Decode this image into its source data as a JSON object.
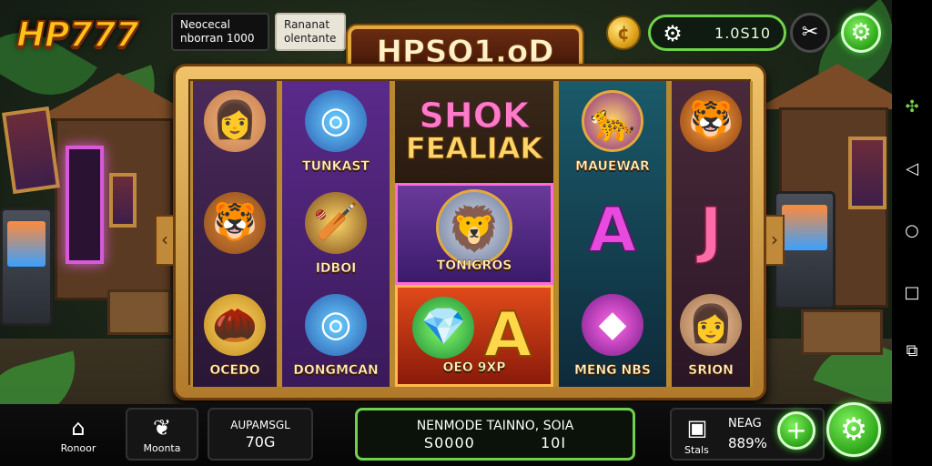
{
  "header": {
    "logo": "HP777",
    "info_left": {
      "line1": "Neocecal",
      "line2": "nborran 1000"
    },
    "info_right": {
      "line1": "Rananat",
      "line2": "olentante"
    },
    "game_title": "HPSO1.oD",
    "balance": "1.0S10"
  },
  "reels": [
    [
      {
        "icon": "woman-portrait-icon",
        "label": ""
      },
      {
        "icon": "tiger-head-icon",
        "label": ""
      },
      {
        "icon": "gold-pinecone-icon",
        "label": "OCEDO"
      }
    ],
    [
      {
        "icon": "blue-ring-icon",
        "label": "TUNKAST"
      },
      {
        "icon": "treasure-bat-icon",
        "label": "IDBOI"
      },
      {
        "icon": "blue-ring-icon",
        "label": "DONGMCAN"
      }
    ],
    [
      {
        "feature_line1": "SHOK",
        "feature_line2": "FEALIAK"
      },
      {
        "icon": "lion-emblem-icon",
        "label": "TONIGROS"
      },
      {
        "icon": "gem-fire-icon",
        "label": "OEO   9XP",
        "letter": "A"
      }
    ],
    [
      {
        "icon": "panther-emblem-icon",
        "label": "MAUEWAR"
      },
      {
        "letter": "A",
        "label": ""
      },
      {
        "icon": "purple-gem-icon",
        "label": "MENG NBS"
      }
    ],
    [
      {
        "icon": "tiger-head-icon",
        "label": ""
      },
      {
        "letter": "J",
        "label": ""
      },
      {
        "icon": "woman-portrait-icon",
        "label": "SRION"
      }
    ]
  ],
  "bottom": {
    "home_label": "Ronoor",
    "menu_label": "Moonta",
    "autoplay_label": "AUPAMSGL",
    "autoplay_value": "70G",
    "bet_line1": "NENMODE TAINNO, SOIA",
    "bet_line2_a": "S0000",
    "bet_line2_b": "10I",
    "stats_label": "Stals",
    "stats_title": "NEAG",
    "stats_value": "889%"
  },
  "colors": {
    "accent_green": "#6fd24a",
    "gold": "#e3a93c",
    "reel_bg": "#2a1636"
  }
}
